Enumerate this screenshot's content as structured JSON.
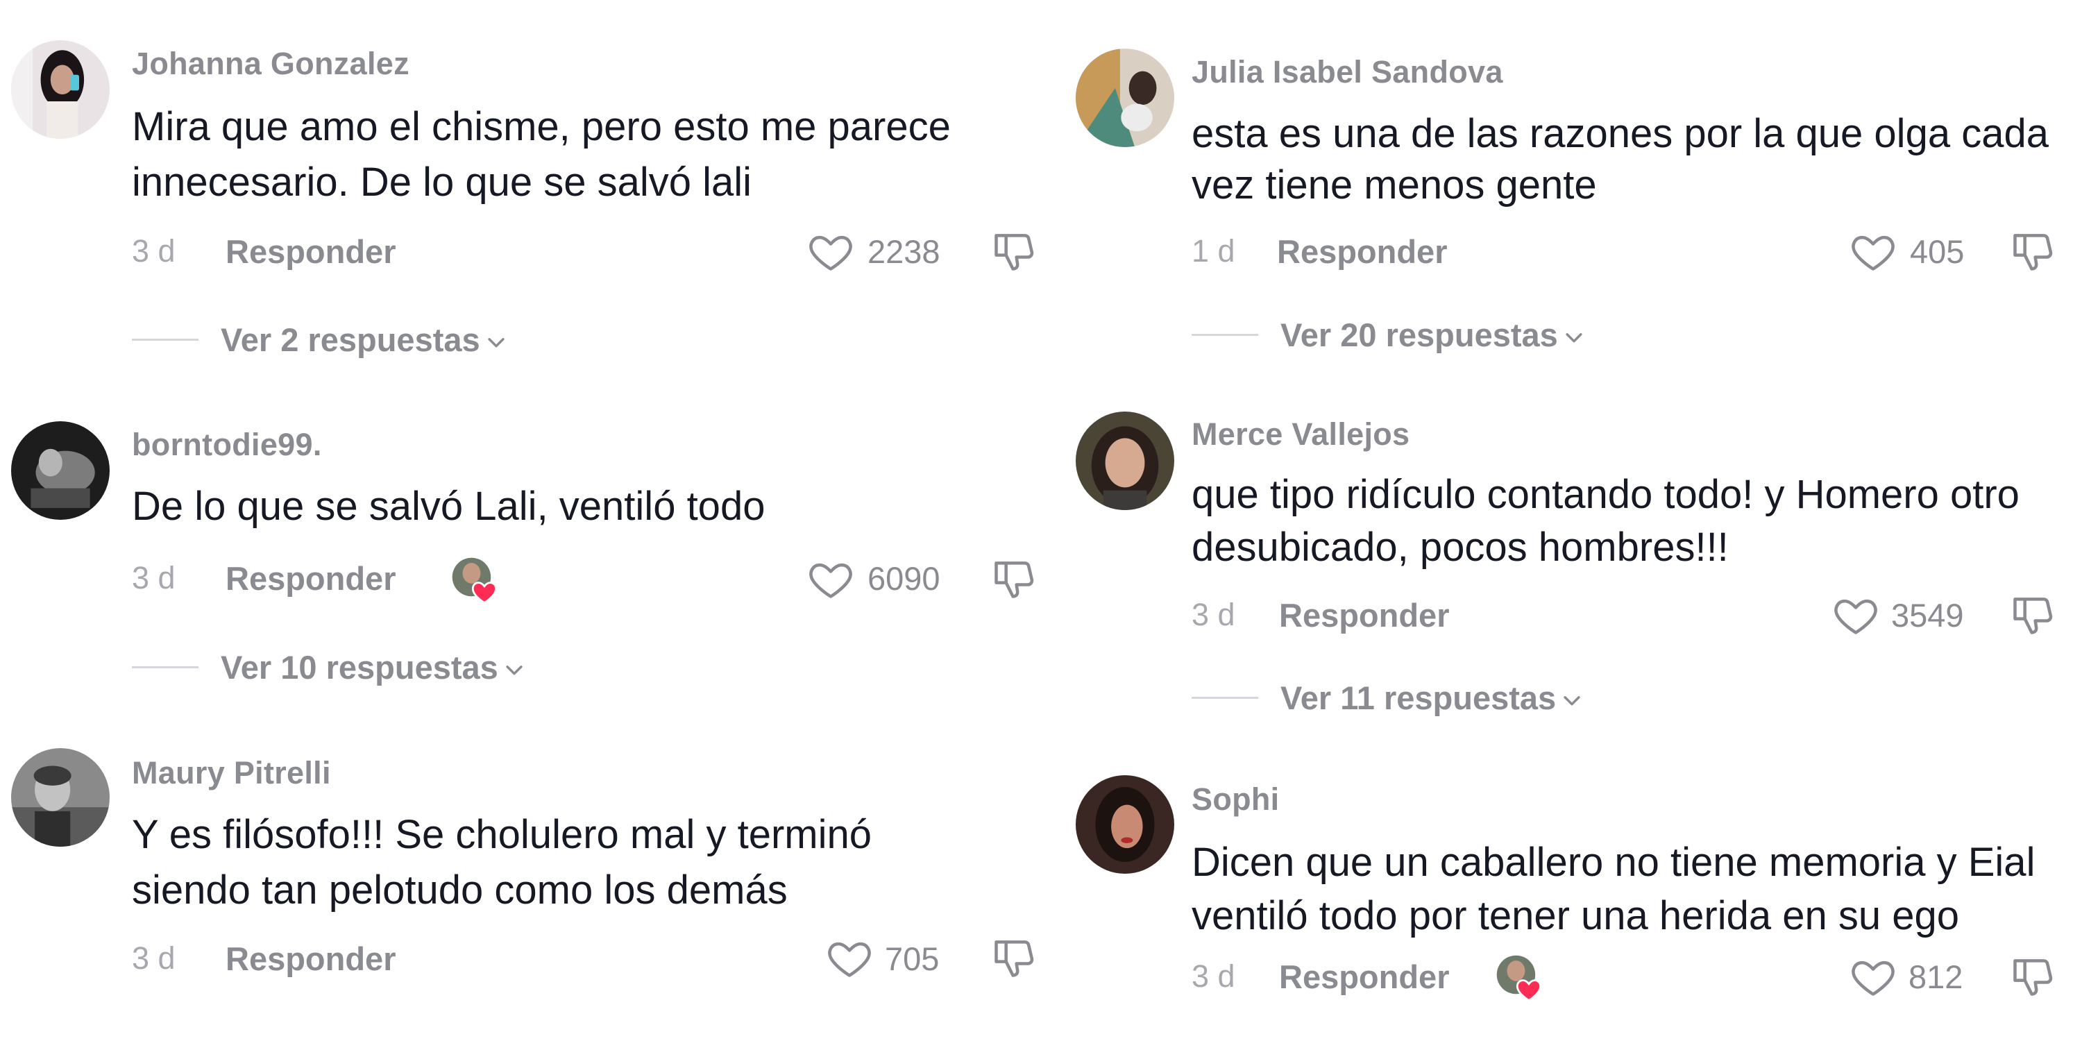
{
  "colors": {
    "username": "#8a8b91",
    "text": "#161823",
    "meta": "#a7a8ad",
    "creator_heart": "#fe2c55"
  },
  "icons": {
    "like": "heart-outline-icon",
    "dislike": "thumbs-down-icon",
    "replies": "chevron-down-icon",
    "creator_liked": "creator-avatar-heart-icon"
  },
  "comments": [
    {
      "username": "Johanna Gonzalez",
      "text_lines": [
        "Mira que amo el chisme, pero esto me parece",
        "innecesario. De lo que se salvó lali"
      ],
      "date": "3 d",
      "reply_label": "Responder",
      "likes": "2238",
      "replies_label": "Ver 2 respuestas",
      "creator_liked": false
    },
    {
      "username": "borntodie99.",
      "text_lines": [
        "De lo que se salvó Lali, ventiló todo"
      ],
      "date": "3 d",
      "reply_label": "Responder",
      "likes": "6090",
      "replies_label": "Ver 10 respuestas",
      "creator_liked": true
    },
    {
      "username": "Maury Pitrelli",
      "text_lines": [
        "Y es filósofo!!! Se cholulero mal y terminó",
        "siendo tan pelotudo como los demás"
      ],
      "date": "3 d",
      "reply_label": "Responder",
      "likes": "705",
      "replies_label": "",
      "creator_liked": false
    },
    {
      "username": "Julia Isabel Sandova",
      "text_lines": [
        "esta es una de las razones por la que olga cada",
        "vez tiene menos gente"
      ],
      "date": "1 d",
      "reply_label": "Responder",
      "likes": "405",
      "replies_label": "Ver 20 respuestas",
      "creator_liked": false
    },
    {
      "username": "Merce Vallejos",
      "text_lines": [
        "que tipo ridículo contando todo! y Homero otro",
        "desubicado, pocos hombres!!!"
      ],
      "date": "3 d",
      "reply_label": "Responder",
      "likes": "3549",
      "replies_label": "Ver 11 respuestas",
      "creator_liked": false
    },
    {
      "username": "Sophi",
      "text_lines": [
        "Dicen que un caballero no tiene memoria y Eial",
        "ventiló todo por tener una herida en su ego"
      ],
      "date": "3 d",
      "reply_label": "Responder",
      "likes": "812",
      "replies_label": "",
      "creator_liked": true
    }
  ]
}
